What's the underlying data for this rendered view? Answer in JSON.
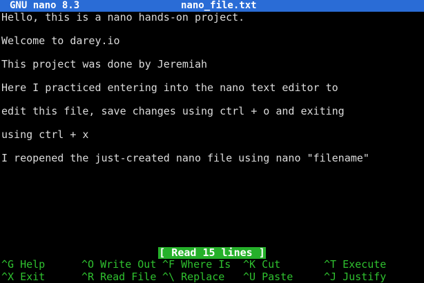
{
  "titlebar": {
    "app": "GNU nano 8.3",
    "filename": "nano_file.txt"
  },
  "content": {
    "lines": [
      "Hello, this is a nano hands-on project.",
      "Welcome to darey.io",
      "This project was done by Jeremiah",
      "Here I practiced entering into the nano text editor to",
      "edit this file, save changes using ctrl + o and exiting",
      "using ctrl + x",
      "I reopened the just-created nano file using nano \"filename\""
    ]
  },
  "status": {
    "message": "[ Read 15 lines ]"
  },
  "shortcuts": {
    "row1": [
      {
        "key": "^G",
        "label": "Help"
      },
      {
        "key": "^O",
        "label": "Write Out"
      },
      {
        "key": "^F",
        "label": "Where Is"
      },
      {
        "key": "^K",
        "label": "Cut"
      },
      {
        "key": "^T",
        "label": "Execute"
      }
    ],
    "row2": [
      {
        "key": "^X",
        "label": "Exit"
      },
      {
        "key": "^R",
        "label": "Read File"
      },
      {
        "key": "^\\",
        "label": "Replace"
      },
      {
        "key": "^U",
        "label": "Paste"
      },
      {
        "key": "^J",
        "label": "Justify"
      }
    ]
  },
  "colors": {
    "background": "#000000",
    "titlebar": "#2a6cd6",
    "status_bg": "#25b02a",
    "shortcut_text": "#2fc12f",
    "body_text": "#dcdcdc"
  }
}
